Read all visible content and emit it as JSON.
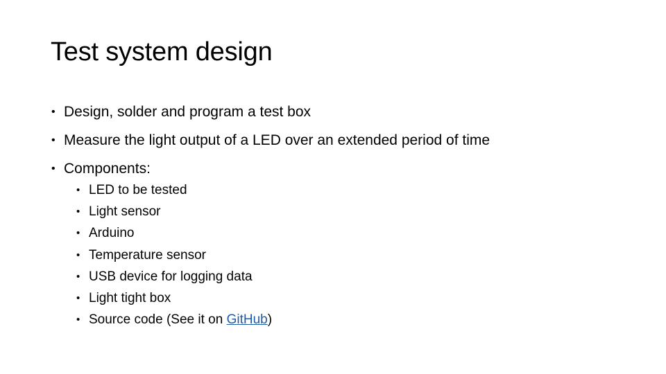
{
  "slide": {
    "title": "Test system design",
    "bullets": [
      "Design, solder and program a test box",
      "Measure the light output of a LED over an extended period of time",
      "Components:"
    ],
    "components": [
      "LED to be tested",
      "Light sensor",
      "Arduino",
      "Temperature sensor",
      "USB device for logging data",
      "Light tight box"
    ],
    "source_code": {
      "prefix": "Source code (See it on ",
      "link_text": "GitHub",
      "suffix": ")"
    },
    "bullet_glyph": "•",
    "link_color": "#1f5aa6"
  }
}
